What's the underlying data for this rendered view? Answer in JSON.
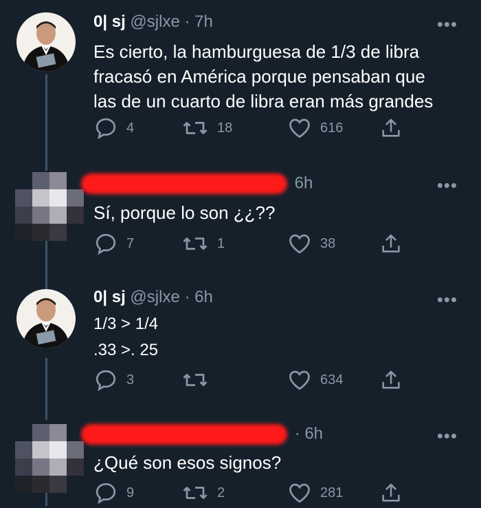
{
  "tweets": [
    {
      "name": "0| sj",
      "handle": "@sjlxe",
      "time": "· 7h",
      "text_lines": [
        "Es cierto, la hamburguesa de 1/3 de libra",
        "fracasó en América porque pensaban que",
        "las de un cuarto de libra eran más grandes"
      ],
      "replies": "4",
      "retweets": "18",
      "likes": "616"
    },
    {
      "name": "",
      "handle": "",
      "time": "6h",
      "text_lines": [
        "Sí, porque lo son ¿¿??"
      ],
      "replies": "7",
      "retweets": "1",
      "likes": "38"
    },
    {
      "name": "0| sj",
      "handle": "@sjlxe",
      "time": "· 6h",
      "text_lines": [
        "1/3 > 1/4",
        ".33 >. 25"
      ],
      "replies": "3",
      "retweets": "",
      "likes": "634"
    },
    {
      "name": "",
      "handle": "",
      "time": "· 6h",
      "text_lines": [
        "¿Qué son esos signos?"
      ],
      "replies": "9",
      "retweets": "2",
      "likes": "281"
    }
  ],
  "more_label": "•••",
  "colors": {
    "background": "#15202b",
    "text": "#ffffff",
    "muted": "#8899a6",
    "redaction": "#ff1a1a"
  }
}
